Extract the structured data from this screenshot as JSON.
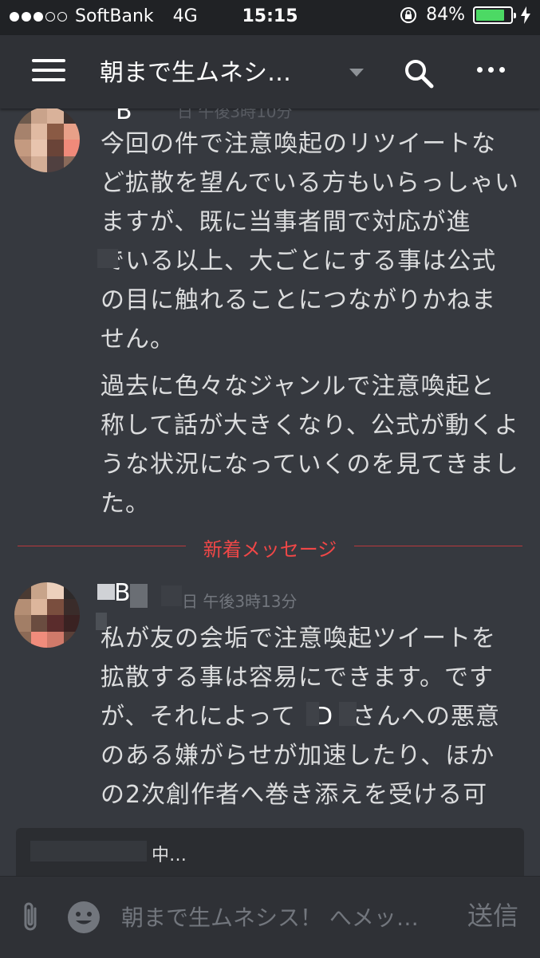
{
  "status_bar": {
    "carrier": "SoftBank",
    "network": "4G",
    "time": "15:15",
    "battery": "84%",
    "battery_level": 0.84,
    "signal_bars_filled": 3,
    "signal_bars_total": 5
  },
  "header": {
    "channel_title": "朝まで生ムネシ…",
    "icons": [
      "menu-icon",
      "chevron-down-icon",
      "search-icon",
      "more-icon"
    ]
  },
  "messages": [
    {
      "author": "B",
      "time": "日 午後3時10分",
      "paragraphs": [
        "今回の件で注意喚起のリツイートなど拡散を望んでいる方もいらっしゃいますが、既に当事者間で対応が進　でいる以上、大ごとにする事は公式の目に触れることにつながりかねません。",
        "過去に色々なジャンルで注意喚起と称して話が大きくなり、公式が動くような状況になっていくのを見てきました。"
      ]
    },
    {
      "author": "B",
      "time": "日 午後3時13分",
      "paragraphs": [
        "私が友の会垢で注意喚起ツイートを拡散する事は容易にできます。ですが、それによって"
      ],
      "mention": "D",
      "paragraphs_after": "さんへの悪意のある嫌がらせが加速したり、ほかの2次創作者へ巻き添えを受ける可"
    }
  ],
  "divider": {
    "label": "新着メッセージ"
  },
  "typing": {
    "text": "中…"
  },
  "composer": {
    "placeholder": "朝まで生ムネシス！ へメッ…",
    "send_label": "送信"
  },
  "colors": {
    "background": "#36393f",
    "header": "#2f3136",
    "status_bar": "#202225",
    "divider": "#f04747",
    "battery": "#4cd964"
  }
}
